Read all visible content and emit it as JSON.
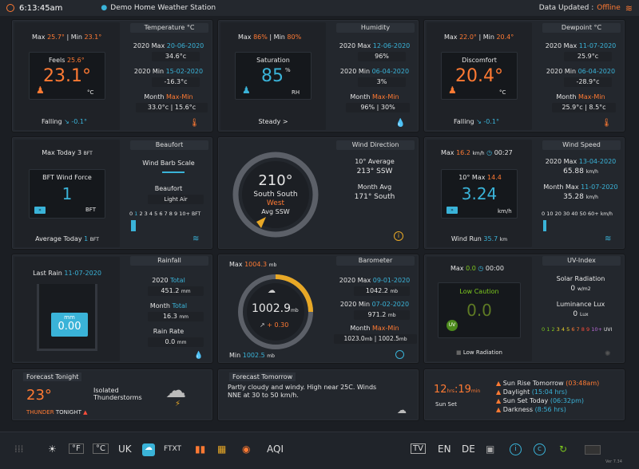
{
  "top": {
    "time": "6:13:45am",
    "station": "Demo Home Weather Station",
    "updated_label": "Data Updated :",
    "updated_status": "Offline"
  },
  "temp": {
    "title": "Temperature °C",
    "max_label": "Max",
    "max": "25.7°",
    "sep": "| Min",
    "min": "23.1°",
    "feels_label": "Feels",
    "feels": "25.6°",
    "value": "23.1°",
    "unit": "°C",
    "trend": "Falling",
    "trend_val": "-0.1°",
    "y_max_label": "2020 Max",
    "y_max_date": "20-06-2020",
    "y_max": "34.6°c",
    "y_min_label": "2020 Min",
    "y_min_date": "15-02-2020",
    "y_min": "-16.3°c",
    "month_label": "Month",
    "month_mm": "Max-Min",
    "month_vals": "33.0°c | 15.6°c"
  },
  "hum": {
    "title": "Humidity",
    "max_label": "Max",
    "max": "86%",
    "sep": "| Min",
    "min": "80%",
    "label": "Saturation",
    "value": "85",
    "pct": "%",
    "unit": "RH",
    "trend": "Steady >",
    "y_max_label": "2020 Max",
    "y_max_date": "12-06-2020",
    "y_max": "96%",
    "y_min_label": "2020 Min",
    "y_min_date": "06-04-2020",
    "y_min": "3%",
    "month_label": "Month",
    "month_mm": "Max-Min",
    "month_vals": "96% | 30%"
  },
  "dew": {
    "title": "Dewpoint °C",
    "max_label": "Max",
    "max": "22.0°",
    "sep": "| Min",
    "min": "20.4°",
    "label": "Discomfort",
    "value": "20.4°",
    "unit": "°C",
    "trend": "Falling",
    "trend_val": "-0.1°",
    "y_max_label": "2020 Max",
    "y_max_date": "11-07-2020",
    "y_max": "25.9°c",
    "y_min_label": "2020 Min",
    "y_min_date": "06-04-2020",
    "y_min": "-28.9°c",
    "month_label": "Month",
    "month_mm": "Max-Min",
    "month_vals": "25.9°c | 8.5°c"
  },
  "beau": {
    "title": "Beaufort",
    "max_today": "Max Today 3",
    "bft": "BFT",
    "label": "BFT Wind Force",
    "value": "1",
    "unit": "BFT",
    "barb": "Wind Barb Scale",
    "bf_label": "Beaufort",
    "bf_desc": "Light Air",
    "scale": [
      "0",
      "1",
      "2",
      "3",
      "4",
      "5",
      "6",
      "7",
      "8",
      "9",
      "10+"
    ],
    "scale_unit": "BFT",
    "avg": "Average Today",
    "avg_val": "1",
    "avg_unit": "BFT"
  },
  "wdir": {
    "title": "Wind Direction",
    "deg": "210°",
    "dir1": "South South",
    "dir2": "West",
    "avg": "Avg SSW",
    "avg10_label": "10° Average",
    "avg10": "213°  SSW",
    "month_label": "Month Avg",
    "month": "171°  South"
  },
  "wspd": {
    "title": "Wind Speed",
    "max_label": "Max",
    "max": "16.2",
    "unit": "km/h",
    "time": "00:27",
    "tenmax_label": "10° Max",
    "tenmax": "14.4",
    "value": "3.24",
    "val_unit": "km/h",
    "y_max_label": "2020 Max",
    "y_max_date": "13-04-2020",
    "y_max": "65.88",
    "y_max_u": "km/h",
    "m_max_label": "Month Max",
    "m_max_date": "11-07-2020",
    "m_max": "35.28",
    "m_max_u": "km/h",
    "scale": [
      "0",
      "10",
      "20",
      "30",
      "40",
      "50",
      "60+"
    ],
    "scale_unit": "km/h",
    "run_label": "Wind Run",
    "run": "35.7",
    "run_u": "km"
  },
  "rain": {
    "title": "Rainfall",
    "last_label": "Last Rain",
    "last_date": "11-07-2020",
    "mm": "mm",
    "value": "0.00",
    "y_label": "2020",
    "y_total": "Total",
    "y_val": "451.2",
    "y_u": "mm",
    "m_label": "Month",
    "m_total": "Total",
    "m_val": "16.3",
    "m_u": "mm",
    "rate_label": "Rain Rate",
    "rate": "0.0",
    "rate_u": "mm"
  },
  "baro": {
    "title": "Barometer",
    "max_label": "Max",
    "max": "1004.3",
    "max_u": "mb",
    "value": "1002.9",
    "unit": "mb",
    "trend": "+ 0.30",
    "min_label": "Min",
    "min": "1002.5",
    "min_u": "mb",
    "y_max_label": "2020 Max",
    "y_max_date": "09-01-2020",
    "y_max": "1042.2",
    "y_max_u": "mb",
    "y_min_label": "2020 Min",
    "y_min_date": "07-02-2020",
    "y_min": "971.2",
    "y_min_u": "mb",
    "month_label": "Month",
    "month_mm": "Max-Min",
    "month_vals": "1023.0",
    "month_vals2": "1002.5",
    "mb": "mb"
  },
  "uv": {
    "title": "UV-Index",
    "max_label": "Max",
    "max": "0.0",
    "time": "00:00",
    "caution": "Low Caution",
    "value": "0.0",
    "uv": "UV",
    "low_rad": "Low Radiation",
    "solar_label": "Solar Radiation",
    "solar": "0",
    "solar_u": "w/m2",
    "lux_label": "Luminance Lux",
    "lux": "0",
    "lux_u": "Lux",
    "scale": [
      "0",
      "1",
      "2",
      "3",
      "4",
      "5",
      "6",
      "7",
      "8",
      "9",
      "10+"
    ],
    "scale_unit": "UVI"
  },
  "fc_tonight": {
    "title": "Forecast Tonight",
    "temp": "23°",
    "desc": "Isolated Thunderstorms",
    "tag": "THUNDER",
    "tag2": "TONIGHT"
  },
  "fc_tomorrow": {
    "title": "Forecast Tomorrow",
    "text": "Partly cloudy and windy. High near 25C. Winds NNE at 30 to 50 km/h."
  },
  "sun": {
    "hrs": "12",
    "hrs_u": "hrs",
    "min": "19",
    "min_u": "min",
    "set_label": "Sun Set",
    "rise_label": "Sun Rise Tomorrow",
    "rise": "(03:48am)",
    "day_label": "Daylight",
    "day": "(15:04 hrs)",
    "setday_label": "Sun Set Today",
    "setday": "(06:32pm)",
    "dark_label": "Darkness",
    "dark": "(8:56 hrs)"
  },
  "bottom": {
    "f": "°F",
    "c": "°C",
    "uk": "UK",
    "ftxt": "FTXT",
    "aqi": "AQI",
    "tv": "TV",
    "en": "EN",
    "de": "DE",
    "ver": "Ver 7.34"
  },
  "colors": {
    "accent": "#3ab3d8",
    "orange": "#ff7a33",
    "offline": "#ff7a33"
  }
}
